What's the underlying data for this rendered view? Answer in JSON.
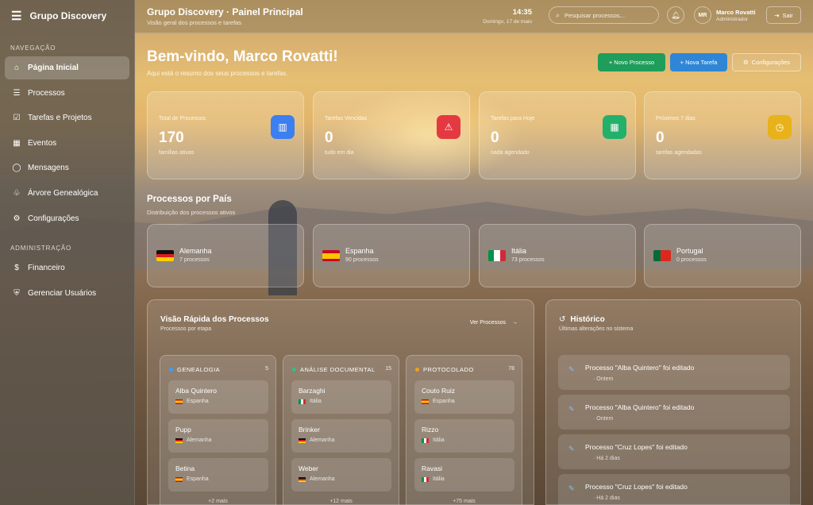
{
  "app": {
    "brand": "Grupo Discovery"
  },
  "sidebar": {
    "nav_label": "NAVEGAÇÃO",
    "items": [
      {
        "label": "Página Inicial",
        "icon": "home-icon"
      },
      {
        "label": "Processos",
        "icon": "list-icon"
      },
      {
        "label": "Tarefas e Projetos",
        "icon": "checkbox-icon"
      },
      {
        "label": "Eventos",
        "icon": "calendar-icon"
      },
      {
        "label": "Mensagens",
        "icon": "chat-icon"
      },
      {
        "label": "Árvore Genealógica",
        "icon": "tree-icon"
      },
      {
        "label": "Configurações",
        "icon": "gear-icon"
      }
    ],
    "admin_label": "ADMINISTRAÇÃO",
    "admin_items": [
      {
        "label": "Financeiro",
        "icon": "dollar-icon"
      },
      {
        "label": "Gerenciar Usuários",
        "icon": "shield-icon"
      }
    ]
  },
  "header": {
    "title": "Grupo Discovery · Painel Principal",
    "subtitle": "Visão geral dos processos e tarefas",
    "time": "14:35",
    "date": "Domingo, 17 de maio",
    "search_placeholder": "Pesquisar processos...",
    "avatar_initials": "MR",
    "user_name": "Marco Rovatti",
    "user_role": "Administrador",
    "logout_label": "Sair"
  },
  "welcome": {
    "title": "Bem-vindo, Marco Rovatti!",
    "subtitle": "Aqui está o resumo dos seus processos e tarefas.",
    "new_process": "+ Novo Processo",
    "new_task": "+ Nova Tarefa",
    "settings": "Configurações"
  },
  "stats": [
    {
      "label": "Total de Processos",
      "value": "170",
      "desc": "famílias ativas",
      "color": "#3b7ff0",
      "icon": "chart-icon"
    },
    {
      "label": "Tarefas Vencidas",
      "value": "0",
      "desc": "tudo em dia",
      "color": "#e53942",
      "icon": "warning-icon"
    },
    {
      "label": "Tarefas para Hoje",
      "value": "0",
      "desc": "nada agendado",
      "color": "#22b06a",
      "icon": "calendar-icon"
    },
    {
      "label": "Próximos 7 dias",
      "value": "0",
      "desc": "tarefas agendadas",
      "color": "#e8b21a",
      "icon": "clock-icon"
    }
  ],
  "countries_section": {
    "title": "Processos por País",
    "subtitle": "Distribuição dos processos ativos"
  },
  "countries": [
    {
      "name": "Alemanha",
      "count": "7 processos"
    },
    {
      "name": "Espanha",
      "count": "90 processos"
    },
    {
      "name": "Itália",
      "count": "73 processos"
    },
    {
      "name": "Portugal",
      "count": "0 processos"
    }
  ],
  "quick": {
    "title": "Visão Rápida dos Processos",
    "subtitle": "Processos por etapa",
    "link": "Ver Processos",
    "columns": [
      {
        "title": "GENEALOGIA",
        "count": "5",
        "color": "#3aa0ff",
        "more": "+2 mais",
        "cards": [
          {
            "name": "Alba Quintero",
            "country": "Espanha"
          },
          {
            "name": "Pupp",
            "country": "Alemanha"
          },
          {
            "name": "Betina",
            "country": "Espanha"
          }
        ]
      },
      {
        "title": "ANÁLISE DOCUMENTAL",
        "count": "15",
        "color": "#2fc08a",
        "more": "+12 mais",
        "cards": [
          {
            "name": "Barzaghi",
            "country": "Itália"
          },
          {
            "name": "Brinker",
            "country": "Alemanha"
          },
          {
            "name": "Weber",
            "country": "Alemanha"
          }
        ]
      },
      {
        "title": "PROTOCOLADO",
        "count": "78",
        "color": "#f0a21a",
        "more": "+75 mais",
        "cards": [
          {
            "name": "Couto Ruiz",
            "country": "Espanha"
          },
          {
            "name": "Rizzo",
            "country": "Itália"
          },
          {
            "name": "Ravasi",
            "country": "Itália"
          }
        ]
      }
    ]
  },
  "history": {
    "title": "Histórico",
    "subtitle": "Últimas alterações no sistema",
    "items": [
      {
        "text": "Processo \"Alba Quintero\" foi editado",
        "when": "Ontem"
      },
      {
        "text": "Processo \"Alba Quintero\" foi editado",
        "when": "Ontem"
      },
      {
        "text": "Processo \"Cruz Lopes\" foi editado",
        "when": "Há 2 dias"
      },
      {
        "text": "Processo \"Cruz Lopes\" foi editado",
        "when": "Há 2 dias"
      }
    ]
  }
}
